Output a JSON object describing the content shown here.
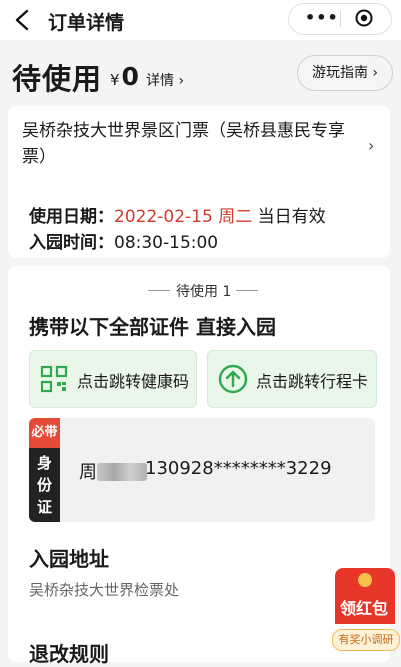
{
  "nav": {
    "title": "订单详情",
    "more_icon": "more-dots-icon",
    "capsule_icon": "target-icon"
  },
  "order": {
    "status": "待使用",
    "price_symbol": "¥",
    "price": "0",
    "detail_label": "详情 ›",
    "guide_button": "游玩指南 ›",
    "ticket_name": "吴桥杂技大世界景区门票（吴桥县惠民专享票）",
    "use_date_label": "使用日期：",
    "use_date": "2022-02-15 周二",
    "use_date_note": "当日有效",
    "entry_time_label": "入园时间：",
    "entry_time": "08:30-15:00"
  },
  "voucher": {
    "pending_label": "待使用 1",
    "carry_title": "携带以下全部证件 直接入园",
    "health_code_button": "点击跳转健康码",
    "itinerary_button": "点击跳转行程卡",
    "must_tag": "必带",
    "id_tag": "身份证",
    "id_name_initial": "周",
    "id_number": "130928********3229"
  },
  "address": {
    "title": "入园地址",
    "text": "吴桥杂技大世界检票处"
  },
  "rules": {
    "title": "退改规则"
  },
  "float": {
    "redpack": "领红包",
    "survey": "有奖小调研"
  },
  "colors": {
    "accent_red": "#d33b2f",
    "green": "#2fa84f",
    "green_bg": "#e9f6ea"
  }
}
